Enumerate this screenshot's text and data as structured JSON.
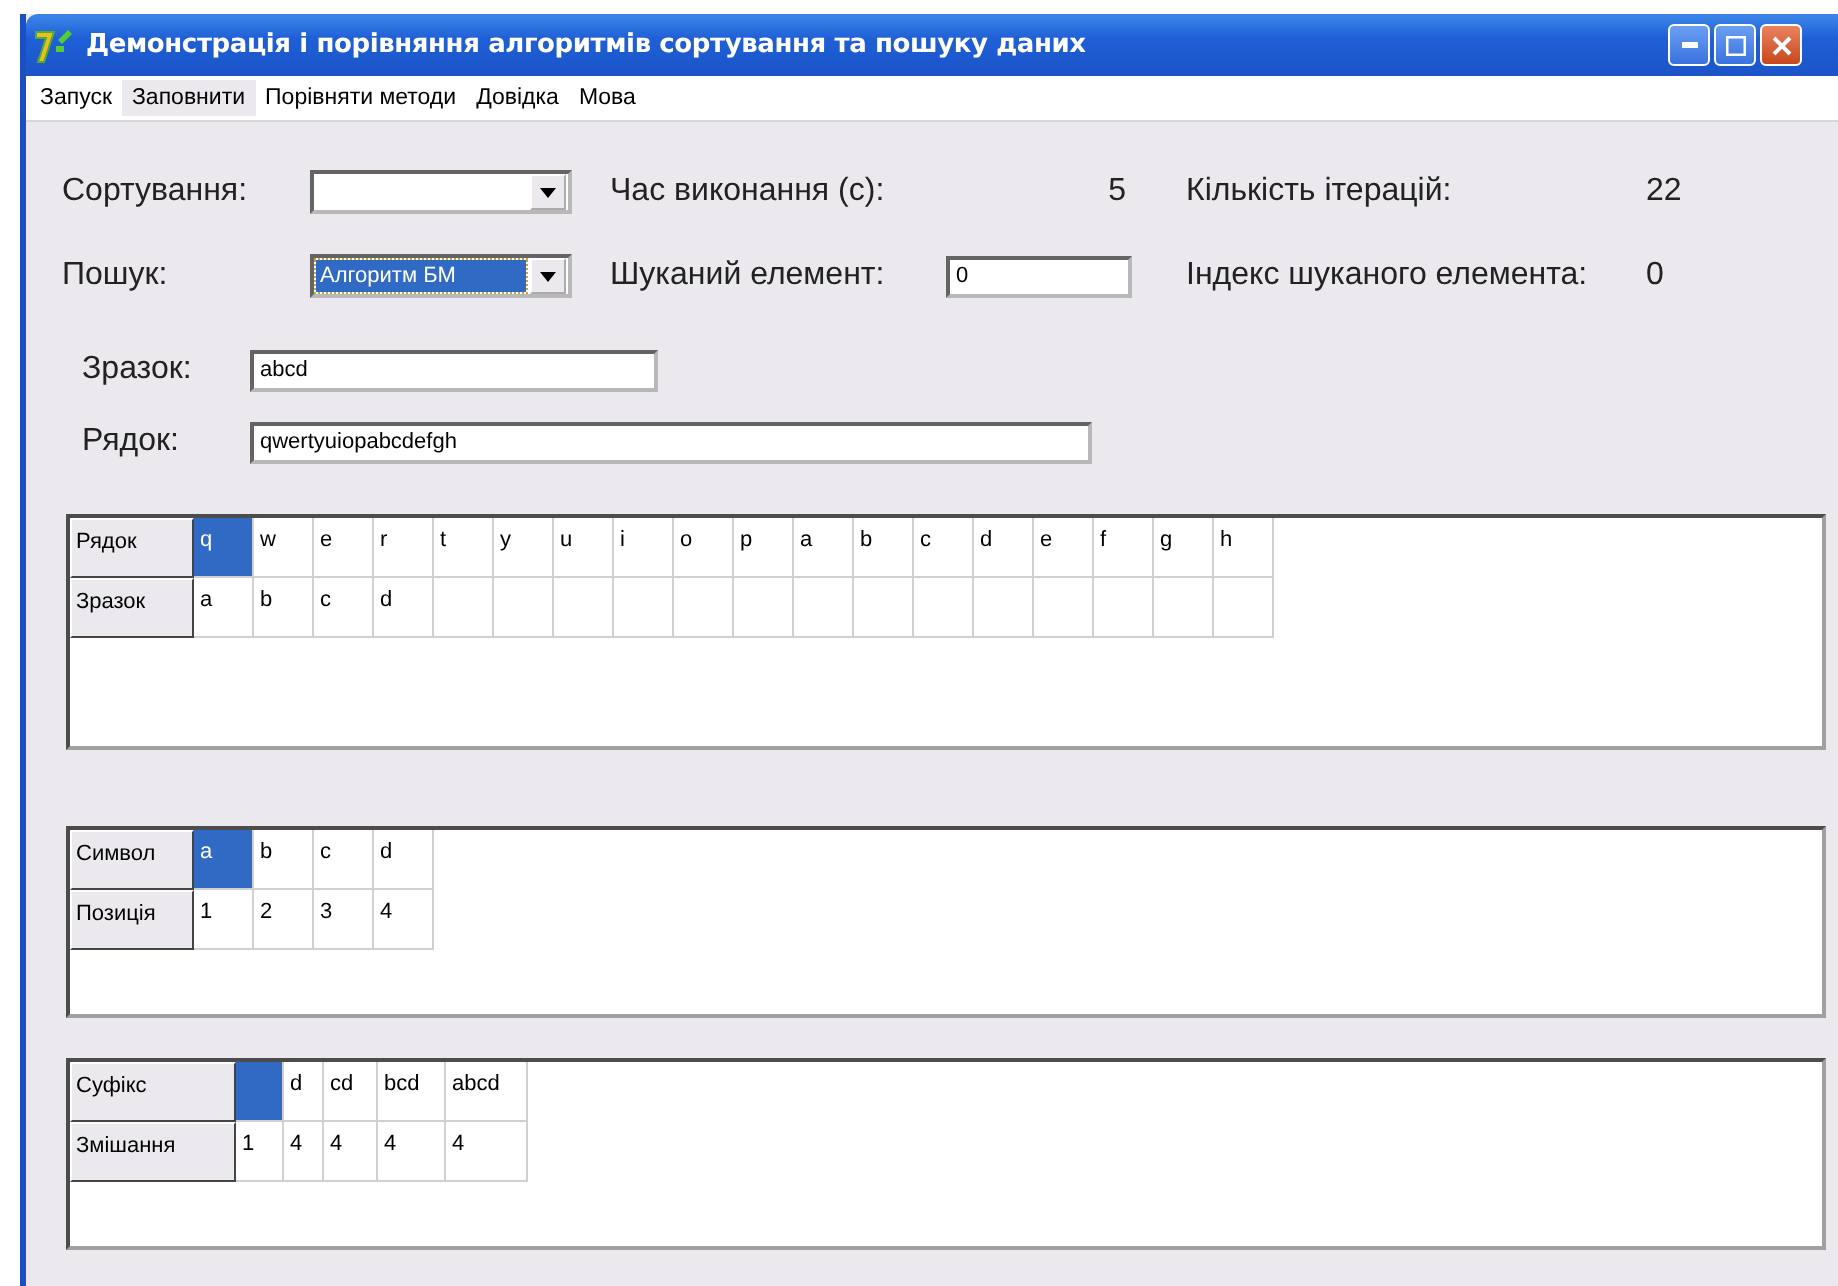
{
  "window": {
    "title": "Демонстрація і порівняння алгоритмів сортування та пошуку даних"
  },
  "menu": [
    {
      "label": "Запуск",
      "selected": false
    },
    {
      "label": "Заповнити",
      "selected": true
    },
    {
      "label": "Порівняти методи",
      "selected": false
    },
    {
      "label": "Довідка",
      "selected": false
    },
    {
      "label": "Мова",
      "selected": false
    }
  ],
  "sort": {
    "label": "Сортування:"
  },
  "time": {
    "label": "Час виконання (с):",
    "value": "5"
  },
  "iterations": {
    "label": "Кількість ітерацій:",
    "value": "22"
  },
  "search": {
    "label": "Пошук:",
    "value": "Алгоритм БМ"
  },
  "target": {
    "label": "Шуканий елемент:",
    "value": "0"
  },
  "index": {
    "label": "Індекс шуканого елемента:",
    "value": "0"
  },
  "pattern": {
    "label": "Зразок:",
    "value": "abcd"
  },
  "text": {
    "label": "Рядок:",
    "value": "qwertyuiopabcdefgh"
  },
  "grids": [
    {
      "rows": [
        {
          "header": "Рядок",
          "cells": [
            {
              "text": "q",
              "selected": true
            },
            {
              "text": "w",
              "selected": false
            },
            {
              "text": "e",
              "selected": false
            },
            {
              "text": "r",
              "selected": false
            },
            {
              "text": "t",
              "selected": false
            },
            {
              "text": "y",
              "selected": false
            },
            {
              "text": "u",
              "selected": false
            },
            {
              "text": "i",
              "selected": false
            },
            {
              "text": "o",
              "selected": false
            },
            {
              "text": "p",
              "selected": false
            },
            {
              "text": "a",
              "selected": false
            },
            {
              "text": "b",
              "selected": false
            },
            {
              "text": "c",
              "selected": false
            },
            {
              "text": "d",
              "selected": false
            },
            {
              "text": "e",
              "selected": false
            },
            {
              "text": "f",
              "selected": false
            },
            {
              "text": "g",
              "selected": false
            },
            {
              "text": "h",
              "selected": false
            }
          ]
        },
        {
          "header": "Зразок",
          "cells": [
            {
              "text": "a",
              "selected": false
            },
            {
              "text": "b",
              "selected": false
            },
            {
              "text": "c",
              "selected": false
            },
            {
              "text": "d",
              "selected": false
            },
            {
              "selected": false
            },
            {
              "selected": false
            },
            {
              "selected": false
            },
            {
              "selected": false
            },
            {
              "selected": false
            },
            {
              "selected": false
            },
            {
              "selected": false
            },
            {
              "selected": false
            },
            {
              "selected": false
            },
            {
              "selected": false
            },
            {
              "selected": false
            },
            {
              "selected": false
            },
            {
              "selected": false
            },
            {
              "selected": false
            }
          ]
        }
      ]
    },
    {
      "rows": [
        {
          "header": "Символ",
          "cells": [
            {
              "text": "a",
              "selected": true
            },
            {
              "text": "b",
              "selected": false
            },
            {
              "text": "c",
              "selected": false
            },
            {
              "text": "d",
              "selected": false
            }
          ]
        },
        {
          "header": "Позиція",
          "cells": [
            {
              "text": "1",
              "selected": false
            },
            {
              "text": "2",
              "selected": false
            },
            {
              "text": "3",
              "selected": false
            },
            {
              "text": "4",
              "selected": false
            }
          ]
        }
      ]
    },
    {
      "rows": [
        {
          "header": "Суфікс",
          "cells": [
            {
              "selected": true
            },
            {
              "text": "d",
              "selected": false
            },
            {
              "text": "cd",
              "selected": false
            },
            {
              "text": "bcd",
              "selected": false
            },
            {
              "text": "abcd",
              "selected": false
            }
          ]
        },
        {
          "header": "Змішання",
          "cells": [
            {
              "text": "1",
              "selected": false
            },
            {
              "text": "4",
              "selected": false
            },
            {
              "text": "4",
              "selected": false
            },
            {
              "text": "4",
              "selected": false
            },
            {
              "text": "4",
              "selected": false
            }
          ]
        }
      ]
    }
  ]
}
